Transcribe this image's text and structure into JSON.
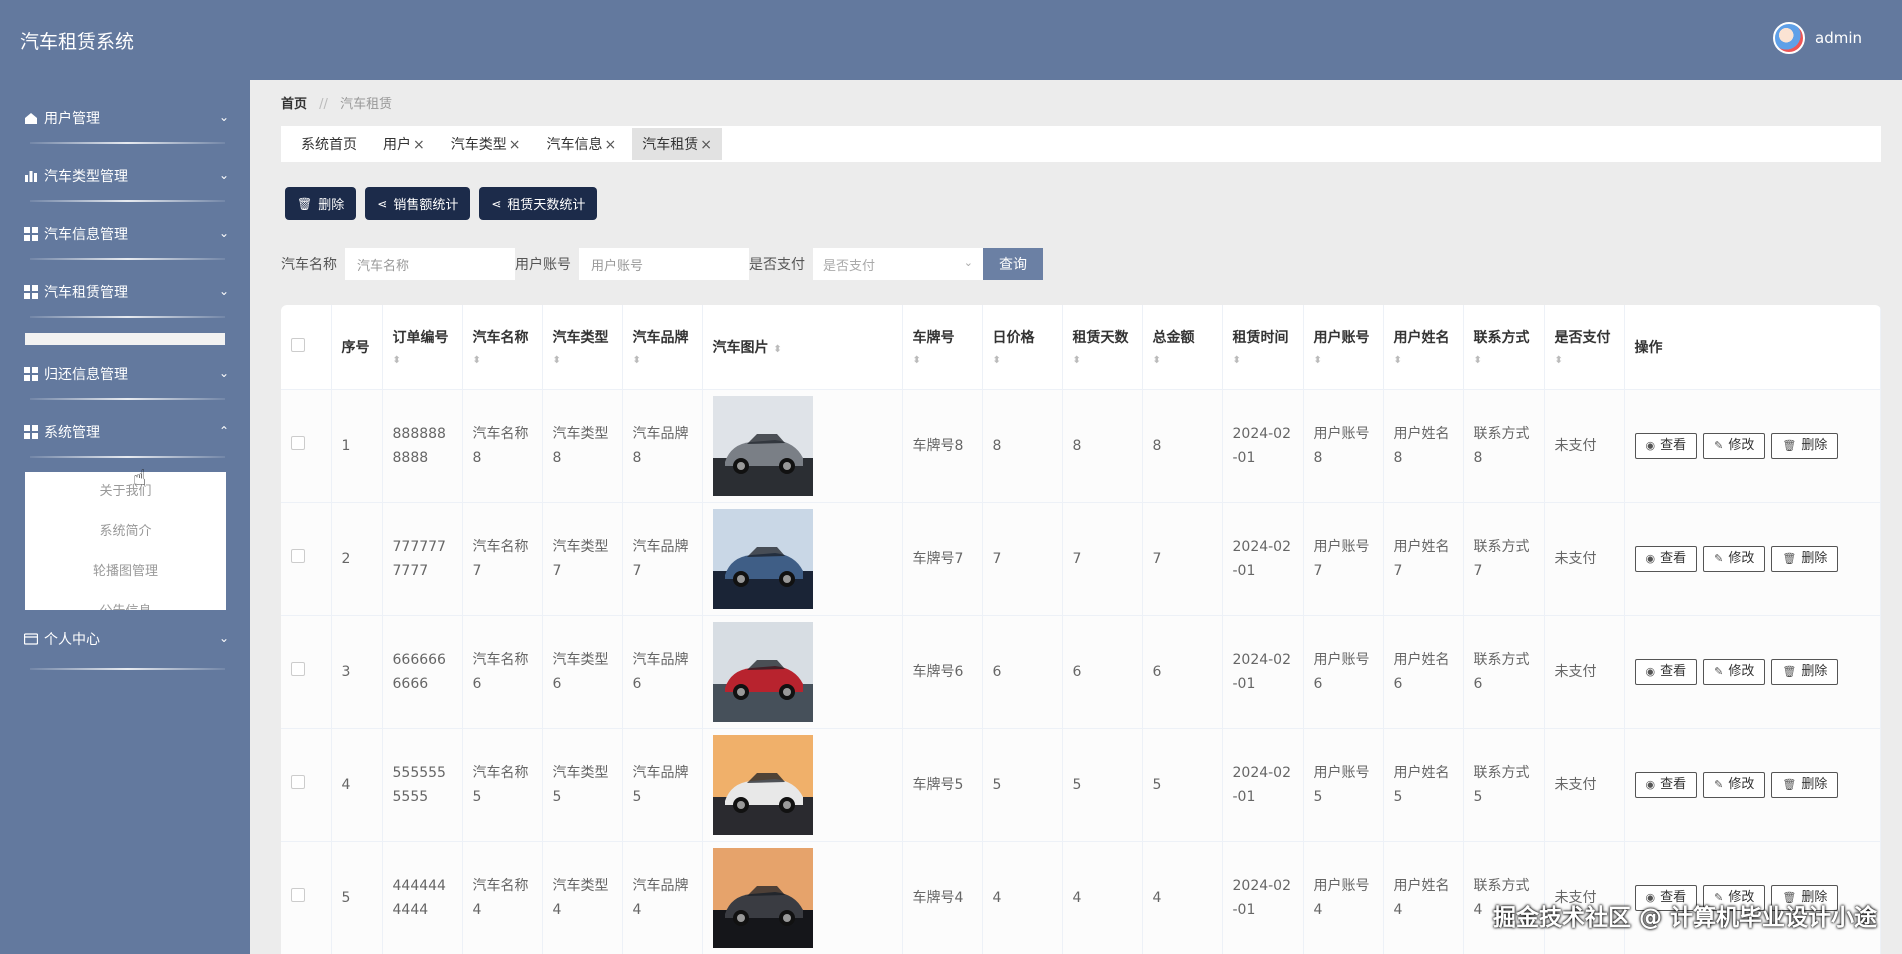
{
  "app": {
    "title": "汽车租赁系统"
  },
  "user": {
    "name": "admin"
  },
  "sidebar": {
    "items": [
      {
        "label": "用户管理",
        "icon": "home-icon"
      },
      {
        "label": "汽车类型管理",
        "icon": "bar-chart-icon"
      },
      {
        "label": "汽车信息管理",
        "icon": "grid-icon"
      },
      {
        "label": "汽车租赁管理",
        "icon": "grid-icon"
      },
      {
        "label": "归还信息管理",
        "icon": "grid-icon"
      },
      {
        "label": "系统管理",
        "icon": "grid-icon"
      },
      {
        "label": "个人中心",
        "icon": "card-icon"
      }
    ],
    "submenu": [
      "关于我们",
      "系统简介",
      "轮播图管理",
      "公告信息"
    ]
  },
  "breadcrumb": {
    "home": "首页",
    "sep": "//",
    "current": "汽车租赁"
  },
  "tabs": [
    {
      "label": "系统首页",
      "closable": false
    },
    {
      "label": "用户",
      "closable": true
    },
    {
      "label": "汽车类型",
      "closable": true
    },
    {
      "label": "汽车信息",
      "closable": true
    },
    {
      "label": "汽车租赁",
      "closable": true
    }
  ],
  "tab_close": "×",
  "toolbar": {
    "delete": "删除",
    "sales_stats": "销售额统计",
    "days_stats": "租赁天数统计"
  },
  "search": {
    "car_name_label": "汽车名称",
    "car_name_placeholder": "汽车名称",
    "account_label": "用户账号",
    "account_placeholder": "用户账号",
    "paid_label": "是否支付",
    "paid_placeholder": "是否支付",
    "query": "查询"
  },
  "table": {
    "columns": [
      "序号",
      "订单编号",
      "汽车名称",
      "汽车类型",
      "汽车品牌",
      "汽车图片",
      "车牌号",
      "日价格",
      "租赁天数",
      "总金额",
      "租赁时间",
      "用户账号",
      "用户姓名",
      "联系方式",
      "是否支付",
      "操作"
    ],
    "rows": [
      {
        "idx": "1",
        "order": "8888888888",
        "name": "汽车名称8",
        "type": "汽车类型8",
        "brand": "汽车品牌8",
        "plate": "车牌号8",
        "price": "8",
        "days": "8",
        "total": "8",
        "time": "2024-02-01",
        "account": "用户账号8",
        "uname": "用户姓名8",
        "contact": "联系方式8",
        "paid": "未支付"
      },
      {
        "idx": "2",
        "order": "7777777777",
        "name": "汽车名称7",
        "type": "汽车类型7",
        "brand": "汽车品牌7",
        "plate": "车牌号7",
        "price": "7",
        "days": "7",
        "total": "7",
        "time": "2024-02-01",
        "account": "用户账号7",
        "uname": "用户姓名7",
        "contact": "联系方式7",
        "paid": "未支付"
      },
      {
        "idx": "3",
        "order": "6666666666",
        "name": "汽车名称6",
        "type": "汽车类型6",
        "brand": "汽车品牌6",
        "plate": "车牌号6",
        "price": "6",
        "days": "6",
        "total": "6",
        "time": "2024-02-01",
        "account": "用户账号6",
        "uname": "用户姓名6",
        "contact": "联系方式6",
        "paid": "未支付"
      },
      {
        "idx": "4",
        "order": "5555555555",
        "name": "汽车名称5",
        "type": "汽车类型5",
        "brand": "汽车品牌5",
        "plate": "车牌号5",
        "price": "5",
        "days": "5",
        "total": "5",
        "time": "2024-02-01",
        "account": "用户账号5",
        "uname": "用户姓名5",
        "contact": "联系方式5",
        "paid": "未支付"
      },
      {
        "idx": "5",
        "order": "4444444444",
        "name": "汽车名称4",
        "type": "汽车类型4",
        "brand": "汽车品牌4",
        "plate": "车牌号4",
        "price": "4",
        "days": "4",
        "total": "4",
        "time": "2024-02-01",
        "account": "用户账号4",
        "uname": "用户姓名4",
        "contact": "联系方式4",
        "paid": "未支付"
      }
    ],
    "actions": {
      "view": "查看",
      "edit": "修改",
      "delete": "删除"
    }
  },
  "watermark": "掘金技术社区 @ 计算机毕业设计小途",
  "colors": {
    "header": "#63799e",
    "dark_button": "#1c2b4a",
    "query_button": "#6b80a4"
  }
}
